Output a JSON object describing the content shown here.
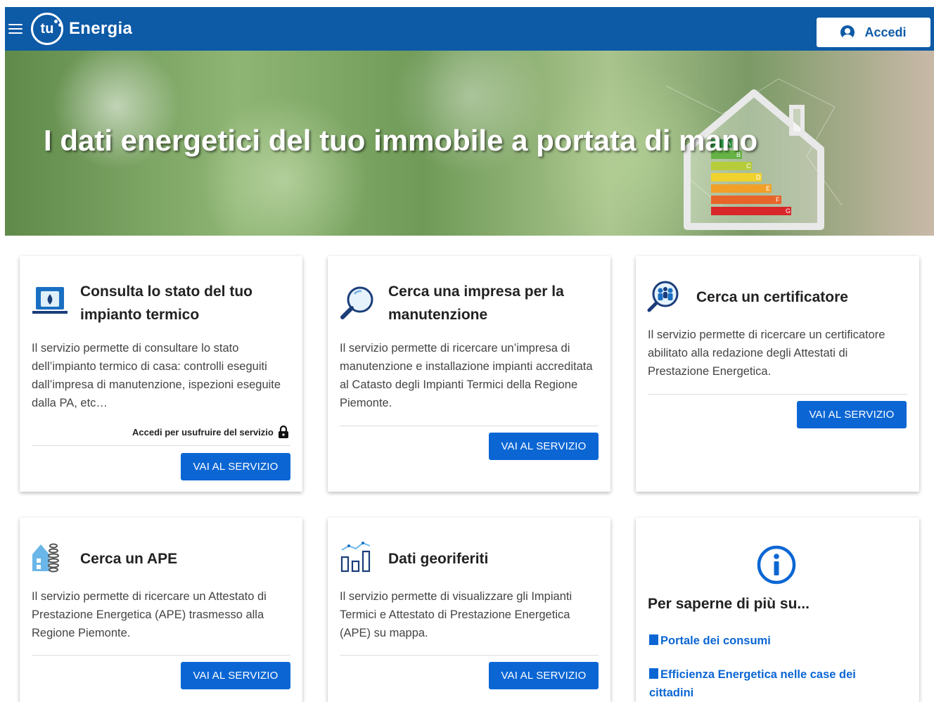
{
  "header": {
    "logo_text": "tu",
    "app_name": "Energia",
    "login_label": "Accedi"
  },
  "hero": {
    "title": "I dati energetici del tuo immobile a portata di mano",
    "energy_classes": [
      "A",
      "B",
      "C",
      "D",
      "E",
      "F",
      "G"
    ]
  },
  "cards": [
    {
      "title": "Consulta lo stato del tuo impianto termico",
      "description": "Il servizio permette di consultare lo stato dell’impianto termico di casa: controlli eseguiti dall’impresa di manutenzione, ispezioni eseguite dalla PA, etc…",
      "login_note": "Accedi per usufruire del servizio",
      "button": "VAI AL SERVIZIO",
      "icon": "boiler-icon"
    },
    {
      "title": "Cerca una impresa per la manutenzione",
      "description": "Il servizio permette di ricercare un’impresa di manutenzione e installazione impianti accreditata al Catasto degli Impianti Termici della Regione Piemonte.",
      "button": "VAI AL SERVIZIO",
      "icon": "magnifier-icon"
    },
    {
      "title": "Cerca un certificatore",
      "description": "Il servizio permette di ricercare un certificatore abilitato alla redazione degli Attestati di Prestazione Energetica.",
      "button": "VAI AL SERVIZIO",
      "icon": "people-search-icon"
    },
    {
      "title": "Cerca un APE",
      "description": "Il servizio permette di ricercare un Attestato di Prestazione Energetica (APE) trasmesso alla Regione Piemonte.",
      "button": "VAI AL SERVIZIO",
      "icon": "building-coil-icon"
    },
    {
      "title": "Dati georiferiti",
      "description": "Il servizio permette di visualizzare gli Impianti Termici e Attestato di Prestazione Energetica (APE) su mappa.",
      "button": "VAI AL SERVIZIO",
      "icon": "bar-graph-icon"
    }
  ],
  "info": {
    "title": "Per saperne di più su...",
    "links": [
      "Portale dei consumi",
      "Efficienza Energetica nelle case dei cittadini"
    ]
  },
  "colors": {
    "header_blue": "#0d5aa7",
    "button_blue": "#0b66d4"
  }
}
